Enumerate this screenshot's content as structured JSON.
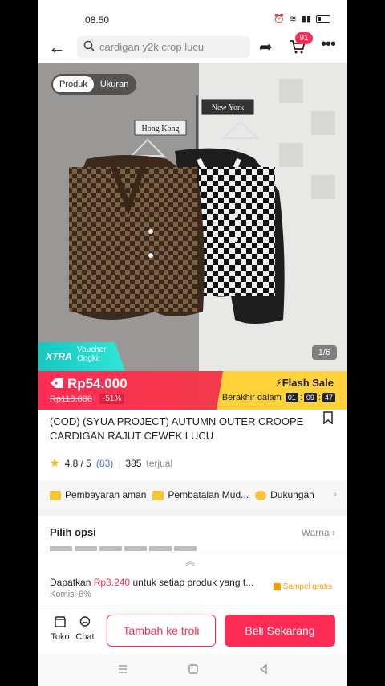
{
  "status": {
    "time": "08.50"
  },
  "header": {
    "search_placeholder": "cardigan y2k crop lucu",
    "cart_count": "91"
  },
  "hero": {
    "tabs": [
      "Produk",
      "Ukuran"
    ],
    "photo_counter": "1/6",
    "signs": [
      "Hong Kong",
      "New York"
    ],
    "xtra_label": "XTRA",
    "xtra_sub": "Voucher Ongkir"
  },
  "price": {
    "current": "Rp54.000",
    "original": "Rp110.000",
    "discount": "-51%",
    "flash_label": "Flash Sale",
    "ends_label": "Berakhir dalam",
    "countdown": [
      "01",
      "09",
      "47"
    ]
  },
  "product": {
    "title": "(COD) (SYUA PROJECT) AUTUMN OUTER CROOPE CARDIGAN RAJUT CEWEK LUCU",
    "rating": "4.8 / 5",
    "reviews": "(83)",
    "sold": "385",
    "sold_label": "terjual"
  },
  "benefits": [
    "Pembayaran aman",
    "Pembatalan Mud...",
    "Dukungan"
  ],
  "options": {
    "title": "Pilih opsi",
    "link": "Warna"
  },
  "affiliate": {
    "prefix": "Dapatkan",
    "amount": "Rp3.240",
    "suffix": "untuk setiap produk yang t...",
    "commission": "Komisi 6%",
    "sample": "Sampel gratis"
  },
  "bottom": {
    "shop": "Toko",
    "chat": "Chat",
    "add_cart": "Tambah ke troli",
    "buy": "Beli Sekarang"
  },
  "colors": {
    "accent": "#fe2c55",
    "flash": "#ffd23a",
    "xtra": "#17c7c0"
  }
}
